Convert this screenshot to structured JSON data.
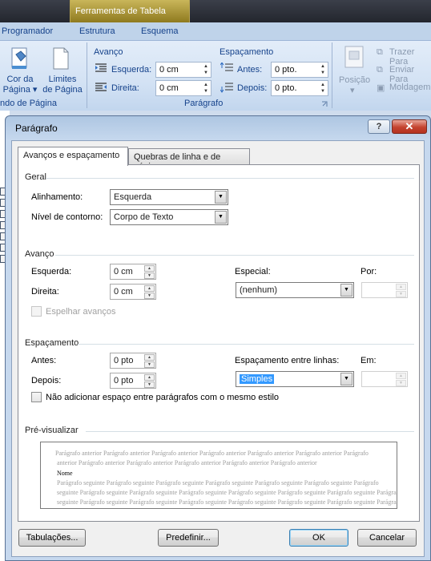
{
  "ribbon": {
    "context_tab": "Ferramentas de Tabela",
    "tabs": [
      "Programador",
      "Estrutura",
      "Esquema"
    ],
    "page_color_label_1": "Cor da",
    "page_color_label_2": "Página",
    "page_borders_label_1": "Limites",
    "page_borders_label_2": "de Página",
    "page_bg_group": "ndo de Página",
    "indent_title": "Avanço",
    "indent_left_label": "Esquerda:",
    "indent_left_value": "0 cm",
    "indent_right_label": "Direita:",
    "indent_right_value": "0 cm",
    "spacing_title": "Espaçamento",
    "spacing_before_label": "Antes:",
    "spacing_before_value": "0 pto.",
    "spacing_after_label": "Depois:",
    "spacing_after_value": "0 pto.",
    "paragraph_group": "Parágrafo",
    "position_label": "Posição",
    "bring_forward": "Trazer Para",
    "send_backward": "Enviar Para",
    "text_wrap": "Moldagem"
  },
  "dialog": {
    "title": "Parágrafo",
    "help": "?",
    "close": "✕",
    "tabs": [
      "Avanços e espaçamento",
      "Quebras de linha e de página"
    ],
    "general": {
      "title": "Geral",
      "alignment_label": "Alinhamento:",
      "alignment_value": "Esquerda",
      "outline_label": "Nível de contorno:",
      "outline_value": "Corpo de Texto"
    },
    "indent": {
      "title": "Avanço",
      "left_label": "Esquerda:",
      "left_value": "0 cm",
      "right_label": "Direita:",
      "right_value": "0 cm",
      "special_label": "Especial:",
      "special_value": "(nenhum)",
      "by_label": "Por:",
      "by_value": "",
      "mirror_label": "Espelhar avanços"
    },
    "spacing": {
      "title": "Espaçamento",
      "before_label": "Antes:",
      "before_value": "0 pto",
      "after_label": "Depois:",
      "after_value": "0 pto",
      "line_spacing_label": "Espaçamento entre linhas:",
      "line_spacing_value": "Simples",
      "at_label": "Em:",
      "at_value": "",
      "no_space_label": "Não adicionar espaço entre parágrafos com o mesmo estilo"
    },
    "preview": {
      "title": "Pré-visualizar",
      "prev_1": "Parágrafo anterior Parágrafo anterior Parágrafo anterior Parágrafo anterior Parágrafo anterior Parágrafo anterior Parágrafo",
      "prev_2": "anterior Parágrafo anterior Parágrafo anterior Parágrafo anterior Parágrafo anterior Parágrafo anterior",
      "current": "Nome",
      "next_1": "Parágrafo seguinte Parágrafo seguinte Parágrafo seguinte Parágrafo seguinte Parágrafo seguinte Parágrafo seguinte Parágrafo",
      "next_2": "seguinte Parágrafo seguinte Parágrafo seguinte Parágrafo seguinte Parágrafo seguinte Parágrafo seguinte Parágrafo seguinte Parágrafo",
      "next_3": "seguinte Parágrafo seguinte Parágrafo seguinte Parágrafo seguinte Parágrafo seguinte Parágrafo seguinte Parágrafo seguinte Parágrafo"
    },
    "buttons": {
      "tabs": "Tabulações...",
      "default": "Predefinir...",
      "ok": "OK",
      "cancel": "Cancelar"
    }
  }
}
